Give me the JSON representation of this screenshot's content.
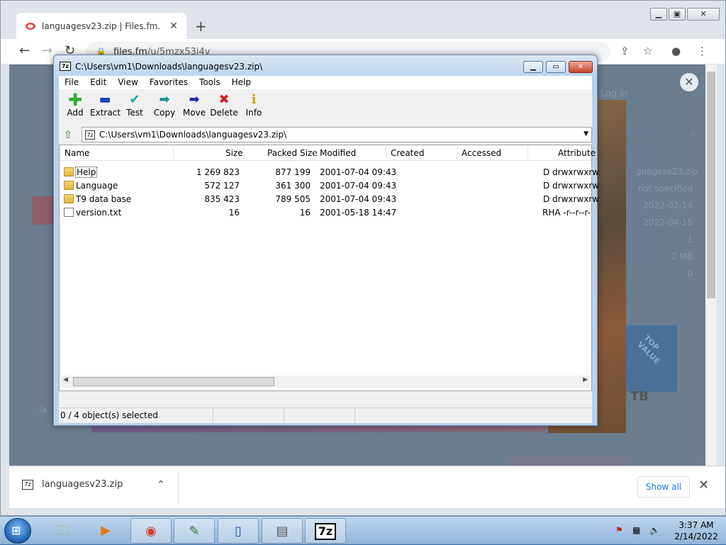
{
  "browser": {
    "tab_title": "languagesv23.zip | Files.fm.",
    "url_host": "files.fm",
    "url_path": "/u/5mzx53j4v",
    "page_hint_login": "Log in",
    "page_right_texts": [
      "guagesv23.zip",
      "not specified",
      "2022-02-14",
      "2022-04-15",
      "1",
      "2 MB",
      "0"
    ],
    "page_tb": "TB",
    "page_badge": "TOP VALUE",
    "page_left_text": "la"
  },
  "downloads": {
    "file_name": "languagesv23.zip",
    "show_all": "Show all"
  },
  "sevenzip": {
    "title": "C:\\Users\\vm1\\Downloads\\languagesv23.zip\\",
    "menu": [
      "File",
      "Edit",
      "View",
      "Favorites",
      "Tools",
      "Help"
    ],
    "toolbar": [
      {
        "label": "Add",
        "icon": "add-icon",
        "glyph": "+",
        "color": "#2fae2f"
      },
      {
        "label": "Extract",
        "icon": "extract-icon",
        "glyph": "—",
        "color": "#1f3fbf"
      },
      {
        "label": "Test",
        "icon": "test-icon",
        "glyph": "✓",
        "color": "#1aa6a6"
      },
      {
        "label": "Copy",
        "icon": "copy-icon",
        "glyph": "➡",
        "color": "#1f8f8f"
      },
      {
        "label": "Move",
        "icon": "move-icon",
        "glyph": "➡",
        "color": "#1f2f9f"
      },
      {
        "label": "Delete",
        "icon": "delete-icon",
        "glyph": "✖",
        "color": "#d01f1f"
      },
      {
        "label": "Info",
        "icon": "info-icon",
        "glyph": "i",
        "color": "#c8a000"
      }
    ],
    "address": "C:\\Users\\vm1\\Downloads\\languagesv23.zip\\",
    "columns": [
      "Name",
      "Size",
      "Packed Size",
      "Modified",
      "Created",
      "Accessed",
      "Attribute"
    ],
    "rows": [
      {
        "name": "Help",
        "size": "1 269 823",
        "packed": "877 199",
        "modified": "2001-07-04 09:43",
        "attr": "D drwxrwxrw",
        "type": "folder"
      },
      {
        "name": "Language",
        "size": "572 127",
        "packed": "361 300",
        "modified": "2001-07-04 09:43",
        "attr": "D drwxrwxrw",
        "type": "folder"
      },
      {
        "name": "T9 data base",
        "size": "835 423",
        "packed": "789 505",
        "modified": "2001-07-04 09:43",
        "attr": "D drwxrwxrw",
        "type": "folder"
      },
      {
        "name": "version.txt",
        "size": "16",
        "packed": "16",
        "modified": "2001-05-18 14:47",
        "attr": "RHA -r--r--r-",
        "type": "file"
      }
    ],
    "status": "0 / 4 object(s) selected"
  },
  "taskbar": {
    "time": "3:37 AM",
    "date": "2/14/2022",
    "apps": [
      {
        "name": "explorer",
        "glyph": "🗀"
      },
      {
        "name": "media-player",
        "glyph": "▶"
      },
      {
        "name": "chrome",
        "glyph": "◉"
      },
      {
        "name": "chart-app",
        "glyph": "✎"
      },
      {
        "name": "phone-app",
        "glyph": "▯"
      },
      {
        "name": "device-app",
        "glyph": "▤"
      },
      {
        "name": "7zip",
        "glyph": "7z"
      }
    ]
  }
}
